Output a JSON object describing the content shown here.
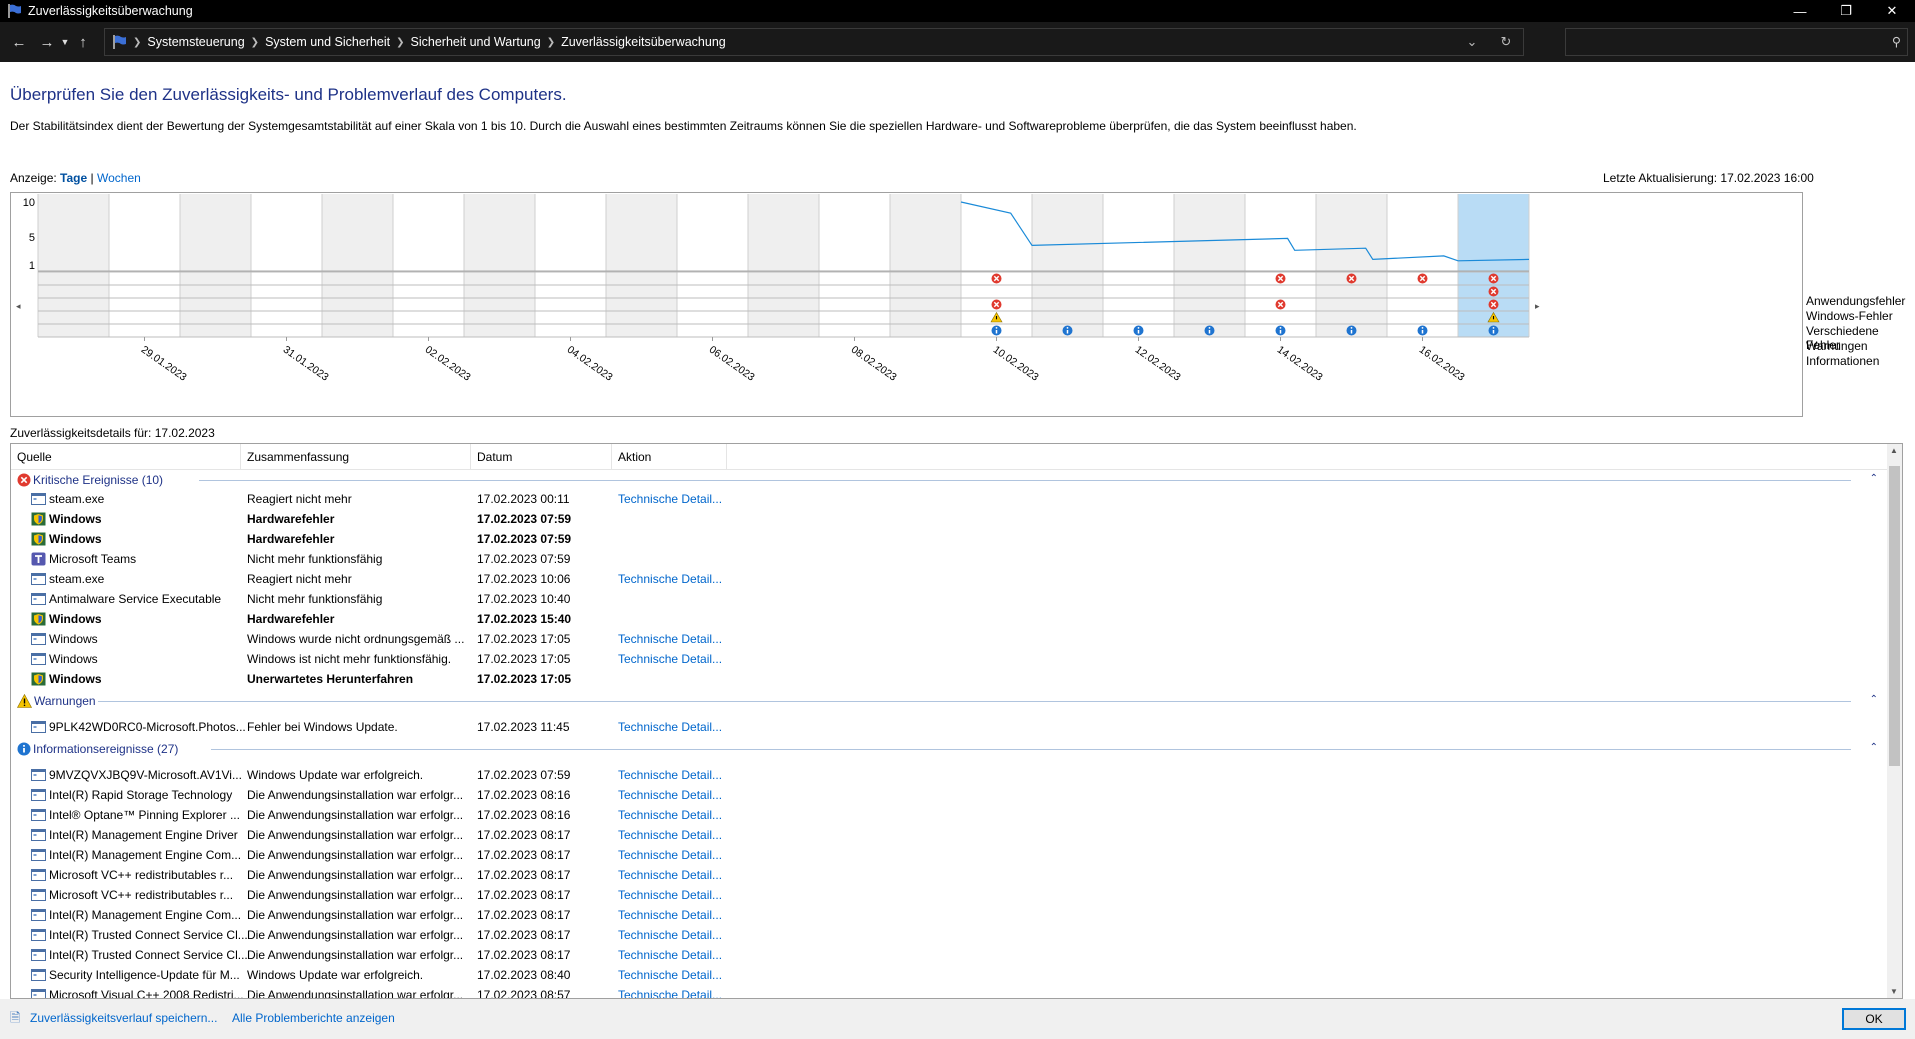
{
  "window": {
    "title": "Zuverlässigkeitsüberwachung"
  },
  "address": {
    "crumbs": [
      "Systemsteuerung",
      "System und Sicherheit",
      "Sicherheit und Wartung",
      "Zuverlässigkeitsüberwachung"
    ]
  },
  "header": {
    "title": "Überprüfen Sie den Zuverlässigkeits- und Problemverlauf des Computers.",
    "description": "Der Stabilitätsindex dient der Bewertung der Systemgesamtstabilität auf einer Skala von 1 bis 10. Durch die Auswahl eines bestimmten Zeitraums können Sie die speziellen Hardware- und Softwareprobleme überprüfen, die das System beeinflusst haben.",
    "view_label": "Anzeige:",
    "view_days": "Tage",
    "view_sep": "|",
    "view_weeks": "Wochen",
    "last_update": "Letzte Aktualisierung: 17.02.2023 16:00"
  },
  "chart_data": {
    "type": "line",
    "title": "",
    "ylim": [
      1,
      10
    ],
    "y_ticks": [
      "10",
      "5",
      "1"
    ],
    "x_dates": [
      "28.01.2023",
      "29.01.2023",
      "30.01.2023",
      "31.01.2023",
      "01.02.2023",
      "02.02.2023",
      "03.02.2023",
      "04.02.2023",
      "05.02.2023",
      "06.02.2023",
      "07.02.2023",
      "08.02.2023",
      "09.02.2023",
      "10.02.2023",
      "11.02.2023",
      "12.02.2023",
      "13.02.2023",
      "14.02.2023",
      "15.02.2023",
      "16.02.2023",
      "17.02.2023"
    ],
    "x_tick_labels": [
      "29.01.2023",
      "31.01.2023",
      "02.02.2023",
      "04.02.2023",
      "06.02.2023",
      "08.02.2023",
      "10.02.2023",
      "12.02.2023",
      "14.02.2023",
      "16.02.2023"
    ],
    "stability_points": [
      {
        "x": 13.0,
        "y": 10.0
      },
      {
        "x": 13.7,
        "y": 8.4
      },
      {
        "x": 14.0,
        "y": 3.8
      },
      {
        "x": 17.6,
        "y": 4.8
      },
      {
        "x": 17.7,
        "y": 3.1
      },
      {
        "x": 18.7,
        "y": 3.4
      },
      {
        "x": 18.8,
        "y": 1.8
      },
      {
        "x": 19.8,
        "y": 2.3
      },
      {
        "x": 20.0,
        "y": 1.6
      },
      {
        "x": 21.0,
        "y": 1.8
      }
    ],
    "selected_index": 20,
    "rows": [
      "Anwendungsfehler",
      "Windows-Fehler",
      "Verschiedene Fehler",
      "Warnungen",
      "Informationen"
    ],
    "markers": [
      {
        "row": 0,
        "cols": [
          13,
          17,
          18,
          19,
          20
        ],
        "kind": "error"
      },
      {
        "row": 1,
        "cols": [
          20
        ],
        "kind": "error"
      },
      {
        "row": 2,
        "cols": [
          13,
          17,
          20
        ],
        "kind": "error"
      },
      {
        "row": 3,
        "cols": [
          13,
          20
        ],
        "kind": "warning"
      },
      {
        "row": 4,
        "cols": [
          13,
          14,
          15,
          16,
          17,
          18,
          19,
          20
        ],
        "kind": "info"
      }
    ]
  },
  "details": {
    "label": "Zuverlässigkeitsdetails für: 17.02.2023",
    "columns": [
      "Quelle",
      "Zusammenfassung",
      "Datum",
      "Aktion"
    ],
    "groups": [
      {
        "title": "Kritische Ereignisse (10)",
        "icon": "error-icon",
        "rows": [
          {
            "src": "steam.exe",
            "sum": "Reagiert nicht mehr",
            "dt": "17.02.2023 00:11",
            "act": "Technische Detail...",
            "icon": "app-icon",
            "bold": false
          },
          {
            "src": "Windows",
            "sum": "Hardwarefehler",
            "dt": "17.02.2023 07:59",
            "act": "",
            "icon": "windows-shield-icon",
            "bold": true
          },
          {
            "src": "Windows",
            "sum": "Hardwarefehler",
            "dt": "17.02.2023 07:59",
            "act": "",
            "icon": "windows-shield-icon",
            "bold": true
          },
          {
            "src": "Microsoft Teams",
            "sum": "Nicht mehr funktionsfähig",
            "dt": "17.02.2023 07:59",
            "act": "",
            "icon": "teams-icon",
            "bold": false
          },
          {
            "src": "steam.exe",
            "sum": "Reagiert nicht mehr",
            "dt": "17.02.2023 10:06",
            "act": "Technische Detail...",
            "icon": "app-icon",
            "bold": false
          },
          {
            "src": "Antimalware Service Executable",
            "sum": "Nicht mehr funktionsfähig",
            "dt": "17.02.2023 10:40",
            "act": "",
            "icon": "app-icon",
            "bold": false
          },
          {
            "src": "Windows",
            "sum": "Hardwarefehler",
            "dt": "17.02.2023 15:40",
            "act": "",
            "icon": "windows-shield-icon",
            "bold": true
          },
          {
            "src": "Windows",
            "sum": "Windows wurde nicht ordnungsgemäß ...",
            "dt": "17.02.2023 17:05",
            "act": "Technische Detail...",
            "icon": "app-icon",
            "bold": false
          },
          {
            "src": "Windows",
            "sum": "Windows ist nicht mehr funktionsfähig.",
            "dt": "17.02.2023 17:05",
            "act": "Technische Detail...",
            "icon": "app-icon",
            "bold": false
          },
          {
            "src": "Windows",
            "sum": "Unerwartetes Herunterfahren",
            "dt": "17.02.2023 17:05",
            "act": "",
            "icon": "windows-shield-icon",
            "bold": true
          }
        ]
      },
      {
        "title": "Warnungen",
        "icon": "warning-icon",
        "rows": [
          {
            "src": "9PLK42WD0RC0-Microsoft.Photos...",
            "sum": "Fehler bei Windows Update.",
            "dt": "17.02.2023 11:45",
            "act": "Technische Detail...",
            "icon": "app-icon",
            "bold": false
          }
        ]
      },
      {
        "title": "Informationsereignisse (27)",
        "icon": "info-icon",
        "rows": [
          {
            "src": "9MVZQVXJBQ9V-Microsoft.AV1Vi...",
            "sum": "Windows Update war erfolgreich.",
            "dt": "17.02.2023 07:59",
            "act": "Technische Detail...",
            "icon": "app-icon",
            "bold": false
          },
          {
            "src": "Intel(R) Rapid Storage Technology",
            "sum": "Die Anwendungsinstallation war erfolgr...",
            "dt": "17.02.2023 08:16",
            "act": "Technische Detail...",
            "icon": "app-icon",
            "bold": false
          },
          {
            "src": "Intel® Optane™ Pinning Explorer ...",
            "sum": "Die Anwendungsinstallation war erfolgr...",
            "dt": "17.02.2023 08:16",
            "act": "Technische Detail...",
            "icon": "app-icon",
            "bold": false
          },
          {
            "src": "Intel(R) Management Engine Driver",
            "sum": "Die Anwendungsinstallation war erfolgr...",
            "dt": "17.02.2023 08:17",
            "act": "Technische Detail...",
            "icon": "app-icon",
            "bold": false
          },
          {
            "src": "Intel(R) Management Engine Com...",
            "sum": "Die Anwendungsinstallation war erfolgr...",
            "dt": "17.02.2023 08:17",
            "act": "Technische Detail...",
            "icon": "app-icon",
            "bold": false
          },
          {
            "src": "Microsoft VC++ redistributables r...",
            "sum": "Die Anwendungsinstallation war erfolgr...",
            "dt": "17.02.2023 08:17",
            "act": "Technische Detail...",
            "icon": "app-icon",
            "bold": false
          },
          {
            "src": "Microsoft VC++ redistributables r...",
            "sum": "Die Anwendungsinstallation war erfolgr...",
            "dt": "17.02.2023 08:17",
            "act": "Technische Detail...",
            "icon": "app-icon",
            "bold": false
          },
          {
            "src": "Intel(R) Management Engine Com...",
            "sum": "Die Anwendungsinstallation war erfolgr...",
            "dt": "17.02.2023 08:17",
            "act": "Technische Detail...",
            "icon": "app-icon",
            "bold": false
          },
          {
            "src": "Intel(R) Trusted Connect Service Cl...",
            "sum": "Die Anwendungsinstallation war erfolgr...",
            "dt": "17.02.2023 08:17",
            "act": "Technische Detail...",
            "icon": "app-icon",
            "bold": false
          },
          {
            "src": "Intel(R) Trusted Connect Service Cl...",
            "sum": "Die Anwendungsinstallation war erfolgr...",
            "dt": "17.02.2023 08:17",
            "act": "Technische Detail...",
            "icon": "app-icon",
            "bold": false
          },
          {
            "src": "Security Intelligence-Update für M...",
            "sum": "Windows Update war erfolgreich.",
            "dt": "17.02.2023 08:40",
            "act": "Technische Detail...",
            "icon": "app-icon",
            "bold": false
          },
          {
            "src": "Microsoft Visual C++ 2008 Redistri...",
            "sum": "Die Anwendungsinstallation war erfolgr...",
            "dt": "17.02.2023 08:57",
            "act": "Technische Detail...",
            "icon": "app-icon",
            "bold": false
          }
        ]
      }
    ]
  },
  "footer": {
    "save_link": "Zuverlässigkeitsverlauf speichern...",
    "reports_link": "Alle Problemberichte anzeigen",
    "ok_label": "OK"
  },
  "colors": {
    "title_blue": "#1e3287",
    "link_blue": "#0066cc",
    "line_blue": "#1a8ad8",
    "selected_col": "#b9dcf5",
    "error_red": "#e03a2f",
    "warning_yellow": "#f5c400",
    "info_blue": "#1f74d0"
  }
}
